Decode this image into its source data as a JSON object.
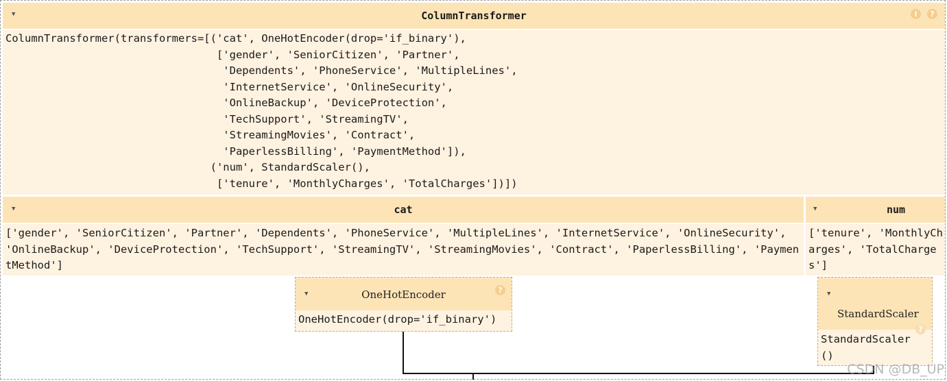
{
  "column_transformer": {
    "title": "ColumnTransformer",
    "code": "ColumnTransformer(transformers=[('cat', OneHotEncoder(drop='if_binary'),\n                                 ['gender', 'SeniorCitizen', 'Partner',\n                                  'Dependents', 'PhoneService', 'MultipleLines',\n                                  'InternetService', 'OnlineSecurity',\n                                  'OnlineBackup', 'DeviceProtection',\n                                  'TechSupport', 'StreamingTV',\n                                  'StreamingMovies', 'Contract',\n                                  'PaperlessBilling', 'PaymentMethod']),\n                                ('num', StandardScaler(),\n                                 ['tenure', 'MonthlyCharges', 'TotalCharges'])])"
  },
  "cat": {
    "title": "cat",
    "columns": "['gender', 'SeniorCitizen', 'Partner', 'Dependents', 'PhoneService', 'MultipleLines', 'InternetService', 'OnlineSecurity', 'OnlineBackup', 'DeviceProtection', 'TechSupport', 'StreamingTV', 'StreamingMovies', 'Contract', 'PaperlessBilling', 'PaymentMethod']"
  },
  "num": {
    "title": "num",
    "columns": "['tenure', 'MonthlyCharges', 'TotalCharges']"
  },
  "onehot": {
    "title": "OneHotEncoder",
    "code": "OneHotEncoder(drop='if_binary')"
  },
  "scaler": {
    "title": "StandardScaler",
    "code": "StandardScaler()"
  },
  "icons": {
    "info": "i",
    "help": "?"
  },
  "watermark": "CSDN @DB_UP"
}
